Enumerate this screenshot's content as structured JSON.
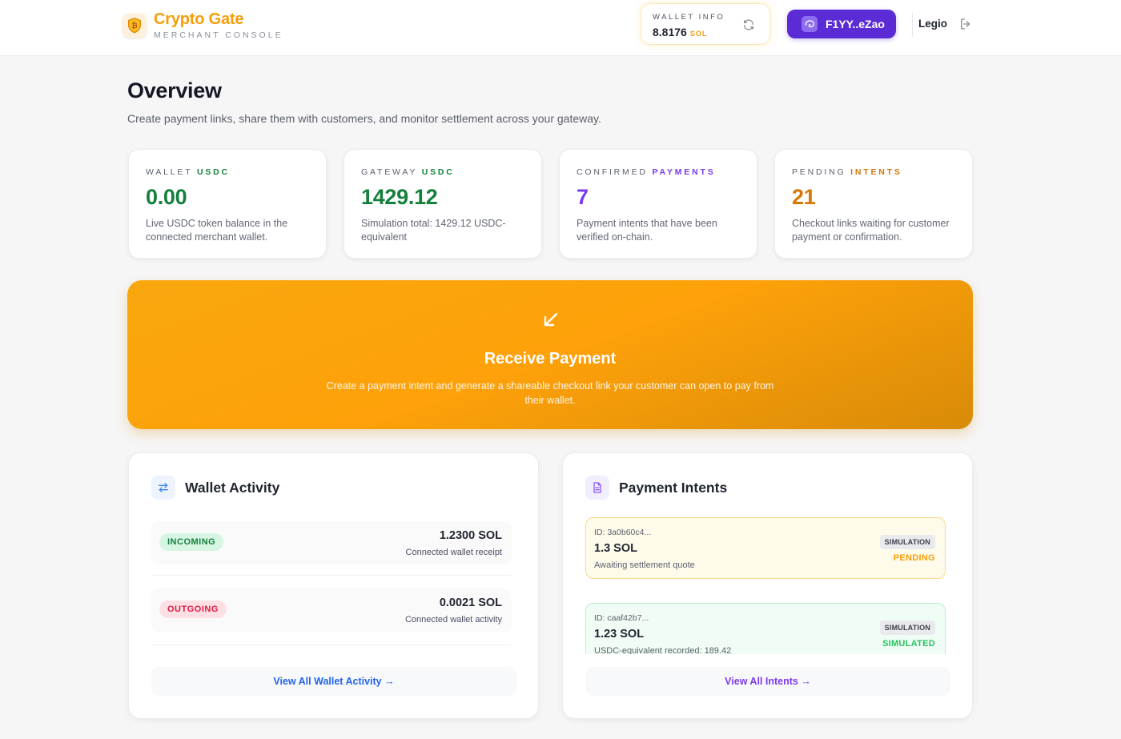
{
  "colors": {
    "accent_orange": "#f59e0b",
    "accent_purple": "#5b2bd6",
    "success_green": "#16a34a",
    "danger_red": "#e11d48"
  },
  "brand": {
    "name": "Crypto Gate",
    "subtitle": "MERCHANT CONSOLE",
    "logo_icon": "shield-bitcoin-icon"
  },
  "wallet_info": {
    "label": "WALLET INFO",
    "balance": "8.8176",
    "unit": "SOL",
    "refresh_icon": "refresh-icon"
  },
  "wallet_button": {
    "label": "F1YY..eZao",
    "icon": "wallet-icon"
  },
  "user": {
    "name": "Legio",
    "logout_icon": "logout-icon"
  },
  "overview": {
    "title": "Overview",
    "subtitle": "Create payment links, share them with customers, and monitor settlement across your gateway."
  },
  "stats": [
    {
      "label": "WALLET",
      "tag": "USDC",
      "value": "0.00",
      "description": "Live USDC token balance in the connected merchant wallet.",
      "color": "#15803d"
    },
    {
      "label": "GATEWAY",
      "tag": "USDC",
      "value": "1429.12",
      "description": "Simulation total: 1429.12 USDC-equivalent",
      "color": "#15803d"
    },
    {
      "label": "CONFIRMED",
      "tag": "PAYMENTS",
      "value": "7",
      "description": "Payment intents that have been verified on-chain.",
      "color": "#7c3aed"
    },
    {
      "label": "PENDING",
      "tag": "INTENTS",
      "value": "21",
      "description": "Checkout links waiting for customer payment or confirmation.",
      "color": "#d97706"
    }
  ],
  "receive": {
    "icon": "arrow-down-left-icon",
    "title": "Receive Payment",
    "description": "Create a payment intent and generate a shareable checkout link your customer can open to pay from their wallet."
  },
  "wallet_activity": {
    "icon": "swap-arrows-icon",
    "title": "Wallet Activity",
    "items": [
      {
        "direction": "INCOMING",
        "amount": "1.2300 SOL",
        "note": "Connected wallet receipt"
      },
      {
        "direction": "OUTGOING",
        "amount": "0.0021 SOL",
        "note": "Connected wallet activity"
      }
    ],
    "view_all": "View All Wallet Activity →"
  },
  "payment_intents": {
    "icon": "document-icon",
    "title": "Payment Intents",
    "items": [
      {
        "id": "ID: 3a0b60c4...",
        "amount": "1.3 SOL",
        "note": "Awaiting settlement quote",
        "badge": "SIMULATION",
        "status": "PENDING"
      },
      {
        "id": "ID: caaf42b7...",
        "amount": "1.23 SOL",
        "note": "USDC-equivalent recorded: 189.42",
        "badge": "SIMULATION",
        "status": "SIMULATED"
      }
    ],
    "view_all": "View All Intents →"
  }
}
